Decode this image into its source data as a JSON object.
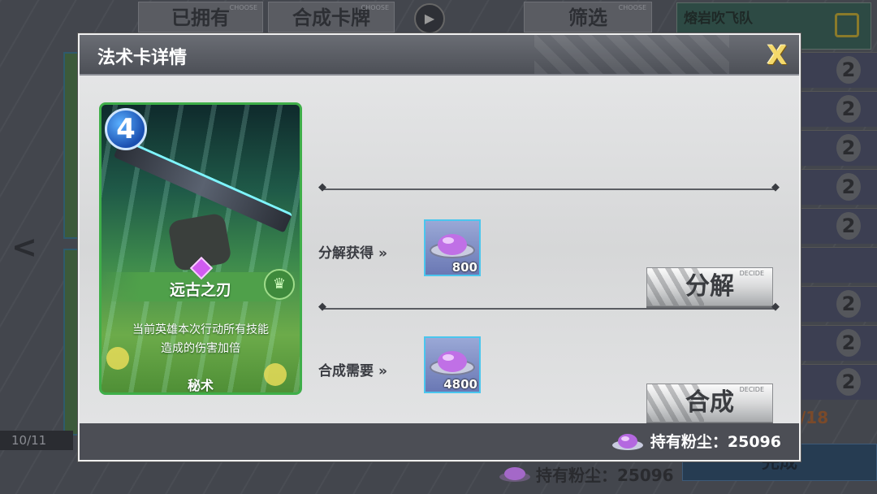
{
  "background": {
    "tabs": [
      {
        "label": "已拥有",
        "tag": "CHOOSE"
      },
      {
        "label": "合成卡牌",
        "tag": "CHOOSE"
      },
      {
        "label": "筛选",
        "tag": "CHOOSE"
      }
    ],
    "team_name": "熔岩吹飞队",
    "deck_counts": [
      "2",
      "2",
      "2",
      "2",
      "2",
      "",
      "2",
      "2",
      "2"
    ],
    "page_counter": "10/11",
    "progress": "/18",
    "dust_label": "持有粉尘：25096",
    "done_label": "完成"
  },
  "modal": {
    "title": "法术卡详情",
    "close_label": "X",
    "card": {
      "cost": "4",
      "name": "远古之刃",
      "description_line1": "当前英雄本次行动所有技能",
      "description_line2": "造成的伤害加倍",
      "type": "秘术",
      "rarity_color": "#d15cf0",
      "frame_color": "#3fae49"
    },
    "disenchant": {
      "label": "分解获得",
      "chevron": "»",
      "item_icon": "arcane-dust-icon",
      "amount": "800",
      "button_label": "分解",
      "button_tag": "DECIDE"
    },
    "craft": {
      "label": "合成需要",
      "chevron": "»",
      "item_icon": "arcane-dust-icon",
      "amount": "4800",
      "button_label": "合成",
      "button_tag": "DECIDE"
    },
    "footer": {
      "dust_icon": "arcane-dust-icon",
      "dust_label": "持有粉尘：25096"
    }
  }
}
